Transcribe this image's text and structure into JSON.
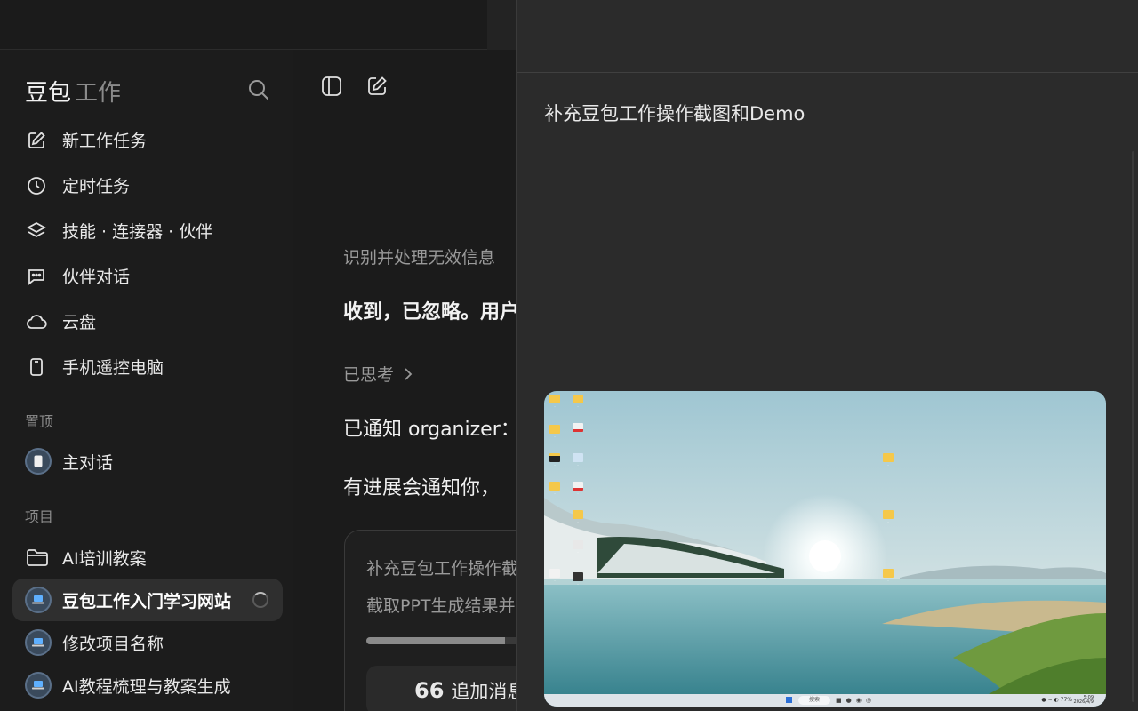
{
  "sidebar": {
    "brand_main": "豆包",
    "brand_sub": "工作",
    "nav": [
      {
        "label": "新工作任务",
        "icon": "edit-icon"
      },
      {
        "label": "定时任务",
        "icon": "clock-icon"
      },
      {
        "label": "技能 · 连接器 · 伙伴",
        "icon": "layers-icon"
      },
      {
        "label": "伙伴对话",
        "icon": "chat-icon"
      },
      {
        "label": "云盘",
        "icon": "cloud-icon"
      },
      {
        "label": "手机遥控电脑",
        "icon": "phone-icon"
      }
    ],
    "pinned_label": "置顶",
    "pinned": [
      {
        "label": "主对话"
      }
    ],
    "projects_label": "项目",
    "projects": [
      {
        "label": "AI培训教案",
        "icon": "folder-icon"
      },
      {
        "label": "豆包工作入门学习网站",
        "active": true
      },
      {
        "label": "修改项目名称"
      },
      {
        "label": "AI教程梳理与教案生成"
      }
    ]
  },
  "main": {
    "line1": "识别并处理无效信息",
    "line2": "收到，已忽略。用户",
    "thinking": "已思考",
    "line3": "已通知 organizer：",
    "line4": "有进展会通知你，",
    "card": {
      "line1": "补充豆包工作操作截图和Demo",
      "line2": "截取PPT生成结果并",
      "progress": 0.65,
      "append_label": "追加消息"
    }
  },
  "panel": {
    "title": "补充豆包工作操作截图和Demo",
    "screenshot": {
      "taskbar_search": "搜索",
      "clock_time": "5:09",
      "clock_date": "2026/4/9",
      "battery": "77%"
    }
  }
}
